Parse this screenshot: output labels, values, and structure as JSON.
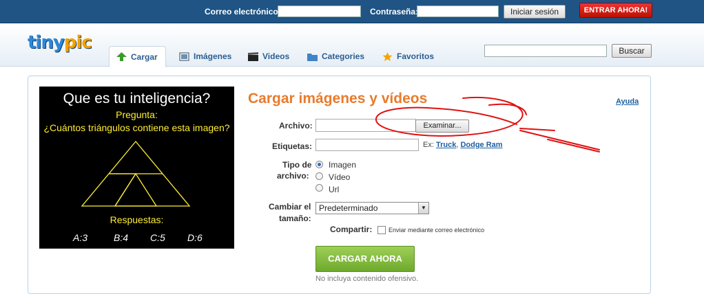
{
  "topbar": {
    "email_label": "Correo electrónico:",
    "email_value": "",
    "password_label": "Contraseña:",
    "password_value": "",
    "login_button": "Iniciar sesión",
    "signup_button": "ENTRAR AHORA!"
  },
  "header": {
    "logo": "tinypic",
    "tabs": [
      {
        "label": "Cargar",
        "icon": "up-arrow-icon",
        "active": true
      },
      {
        "label": "Imágenes",
        "icon": "images-icon"
      },
      {
        "label": "Videos",
        "icon": "clapper-icon"
      },
      {
        "label": "Categories",
        "icon": "folder-icon"
      },
      {
        "label": "Favoritos",
        "icon": "star-icon"
      }
    ],
    "search_value": "",
    "search_button": "Buscar"
  },
  "ad": {
    "question": "Que es tu inteligencia?",
    "prompt_title": "Pregunta:",
    "prompt_text": "¿Cuántos triángulos contiene esta imagen?",
    "answers_title": "Respuestas:",
    "answers": [
      "A:3",
      "B:4",
      "C:5",
      "D:6"
    ]
  },
  "upload": {
    "title": "Cargar imágenes y vídeos",
    "help_link": "Ayuda",
    "file_label": "Archivo:",
    "file_value": "",
    "browse_button": "Examinar...",
    "tags_label": "Etiquetas:",
    "tags_value": "",
    "tags_example_prefix": "Ex:",
    "tags_example_1": "Truck",
    "tags_example_sep": ",",
    "tags_example_2": "Dodge Ram",
    "filetype_label_1": "Tipo de",
    "filetype_label_2": "archivo:",
    "filetype_options": [
      "Imagen",
      "Vídeo",
      "Url"
    ],
    "filetype_selected": "Imagen",
    "resize_label_1": "Cambiar el",
    "resize_label_2": "tamaño:",
    "resize_value": "Predeterminado",
    "share_label": "Compartir:",
    "share_option": "Enviar mediante correo electrónico",
    "share_checked": false,
    "submit_button": "CARGAR AHORA",
    "note": "No incluya contenido ofensivo."
  },
  "colors": {
    "topbar": "#1f5485",
    "title_orange": "#e87b2c",
    "link_blue": "#1d5fa0",
    "upload_green": "#7cb53a",
    "signup_red": "#cc2211"
  }
}
